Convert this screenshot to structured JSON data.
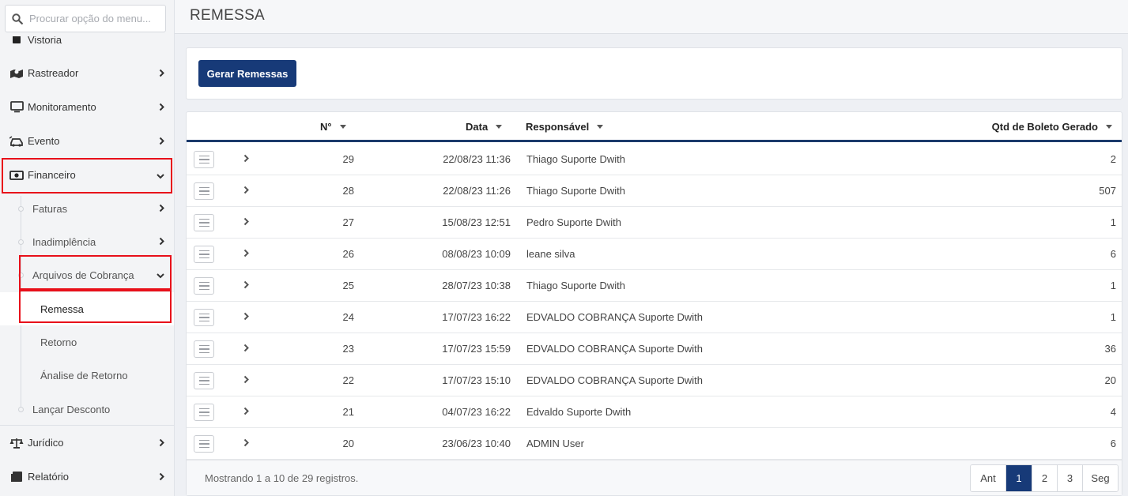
{
  "search": {
    "placeholder": "Procurar opção do menu..."
  },
  "sidebar": {
    "items": [
      {
        "label": "Vistoria",
        "icon": "clipboard-icon"
      },
      {
        "label": "Rastreador",
        "icon": "map-marker-icon"
      },
      {
        "label": "Monitoramento",
        "icon": "monitor-icon"
      },
      {
        "label": "Evento",
        "icon": "car-crash-icon"
      },
      {
        "label": "Financeiro",
        "icon": "money-bill-icon"
      },
      {
        "label": "Jurídico",
        "icon": "balance-scale-icon"
      },
      {
        "label": "Relatório",
        "icon": "report-icon"
      }
    ],
    "financeiro_sub": [
      {
        "label": "Faturas"
      },
      {
        "label": "Inadimplência"
      },
      {
        "label": "Arquivos de Cobrança"
      },
      {
        "label": "Lançar Desconto"
      }
    ],
    "arquivos_sub": [
      {
        "label": "Remessa"
      },
      {
        "label": "Retorno"
      },
      {
        "label": "Ánalise de Retorno"
      }
    ]
  },
  "page": {
    "title": "REMESSA"
  },
  "toolbar": {
    "generate_label": "Gerar Remessas"
  },
  "table": {
    "columns": {
      "number": "N°",
      "date": "Data",
      "responsible": "Responsável",
      "count": "Qtd de Boleto Gerado"
    },
    "rows": [
      {
        "number": "29",
        "date": "22/08/23 11:36",
        "responsible": "Thiago Suporte Dwith",
        "count": "2"
      },
      {
        "number": "28",
        "date": "22/08/23 11:26",
        "responsible": "Thiago Suporte Dwith",
        "count": "507"
      },
      {
        "number": "27",
        "date": "15/08/23 12:51",
        "responsible": "Pedro Suporte Dwith",
        "count": "1"
      },
      {
        "number": "26",
        "date": "08/08/23 10:09",
        "responsible": "leane silva",
        "count": "6"
      },
      {
        "number": "25",
        "date": "28/07/23 10:38",
        "responsible": "Thiago Suporte Dwith",
        "count": "1"
      },
      {
        "number": "24",
        "date": "17/07/23 16:22",
        "responsible": "EDVALDO COBRANÇA Suporte Dwith",
        "count": "1"
      },
      {
        "number": "23",
        "date": "17/07/23 15:59",
        "responsible": "EDVALDO COBRANÇA Suporte Dwith",
        "count": "36"
      },
      {
        "number": "22",
        "date": "17/07/23 15:10",
        "responsible": "EDVALDO COBRANÇA Suporte Dwith",
        "count": "20"
      },
      {
        "number": "21",
        "date": "04/07/23 16:22",
        "responsible": "Edvaldo Suporte Dwith",
        "count": "4"
      },
      {
        "number": "20",
        "date": "23/06/23 10:40",
        "responsible": "ADMIN User",
        "count": "6"
      }
    ]
  },
  "footer": {
    "info": "Mostrando 1 a 10 de 29 registros."
  },
  "pagination": {
    "prev": "Ant",
    "pages": [
      "1",
      "2",
      "3"
    ],
    "next": "Seg",
    "current": "1"
  },
  "colors": {
    "primary": "#173a78",
    "highlight": "#e8101a"
  }
}
